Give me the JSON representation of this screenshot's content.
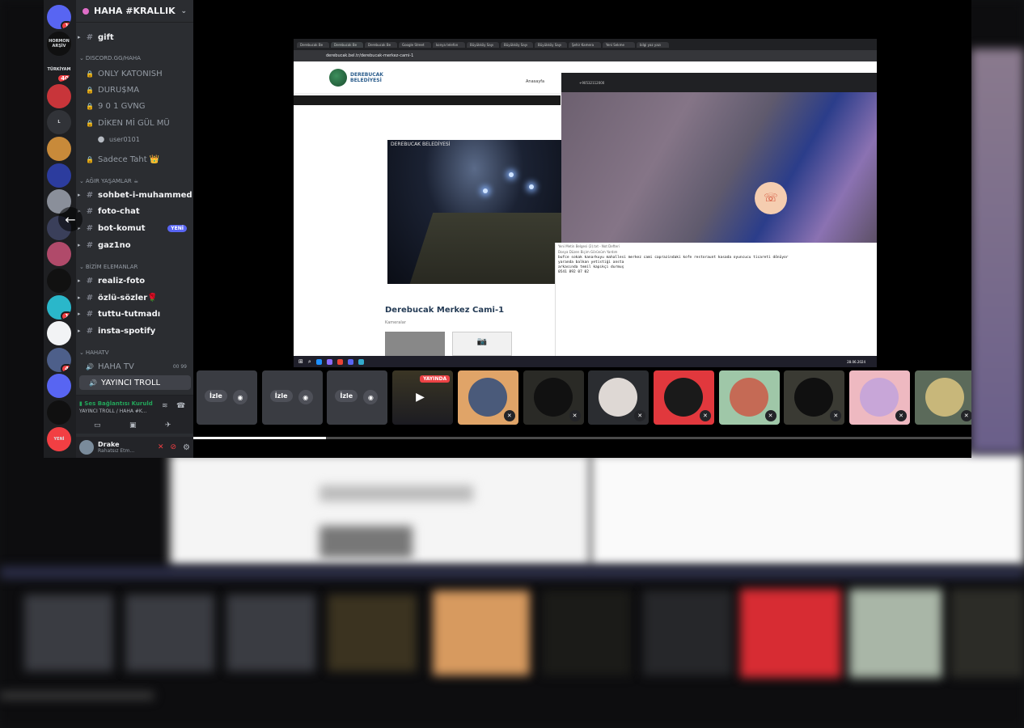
{
  "server": {
    "name": "HAHA #KRALLIK",
    "icons": [
      {
        "label": "",
        "badge": "1",
        "color": "#5865f2"
      },
      {
        "label": "HORMON ARŞİV",
        "badge": "",
        "color": "#101010"
      },
      {
        "label": "TÜRKİYAM",
        "badge": "40",
        "color": "#1e1f22"
      },
      {
        "label": "",
        "badge": "",
        "color": "#c8353a"
      },
      {
        "label": "L",
        "badge": "",
        "color": "#313338"
      },
      {
        "label": "",
        "badge": "",
        "color": "#c88a3a"
      },
      {
        "label": "",
        "badge": "",
        "color": "#2c3c9e"
      },
      {
        "label": "",
        "badge": "",
        "color": "#8a8f9a"
      },
      {
        "label": "",
        "badge": "",
        "color": "#3a3f5a"
      },
      {
        "label": "",
        "badge": "",
        "color": "#b04a6a"
      },
      {
        "label": "",
        "badge": "",
        "color": "#111"
      },
      {
        "label": "",
        "badge": "1",
        "color": "#2ab7ca"
      },
      {
        "label": "",
        "badge": "",
        "color": "#f2f3f5"
      },
      {
        "label": "",
        "badge": "4",
        "color": "#4d5f8a"
      },
      {
        "label": "",
        "badge": "",
        "color": "#5865f2"
      },
      {
        "label": "",
        "badge": "",
        "color": "#101010"
      },
      {
        "label": "YENİ",
        "badge": "",
        "color": "#f23f43"
      }
    ]
  },
  "channels": [
    {
      "type": "text",
      "label": "gift",
      "style": "bright"
    },
    {
      "type": "category",
      "label": "DISCORD.GG/HAHA"
    },
    {
      "type": "locked",
      "label": "ONLY KATONISH"
    },
    {
      "type": "locked",
      "label": "DURU$MA"
    },
    {
      "type": "locked",
      "label": "9 0 1 GVNG"
    },
    {
      "type": "locked",
      "label": "DİKEN Mİ GÜL MÜ"
    },
    {
      "type": "user",
      "label": "user0101"
    },
    {
      "type": "locked",
      "label": "Sadece Taht 👑"
    },
    {
      "type": "category",
      "label": "AĞIR YAŞAMLAR ☕"
    },
    {
      "type": "text",
      "label": "sohbet-i-muhammed",
      "style": "bright"
    },
    {
      "type": "text",
      "label": "foto-chat",
      "style": "bright"
    },
    {
      "type": "text",
      "label": "bot-komut",
      "style": "bright",
      "badge": "YENİ"
    },
    {
      "type": "text",
      "label": "gaz1no",
      "style": "bright"
    },
    {
      "type": "category",
      "label": "BİZİM ELEMANLAR"
    },
    {
      "type": "text",
      "label": "realiz-foto",
      "style": "bright"
    },
    {
      "type": "text",
      "label": "özlü-sözler🌹",
      "style": "bright"
    },
    {
      "type": "text",
      "label": "tuttu-tutmadı",
      "style": "bright"
    },
    {
      "type": "text",
      "label": "insta-spotify",
      "style": "bright"
    },
    {
      "type": "category",
      "label": "HAHATV"
    },
    {
      "type": "voice",
      "label": "HAHA TV",
      "extra": "00 99"
    },
    {
      "type": "voice",
      "label": "YAYINCI TROLL",
      "style": "sel"
    }
  ],
  "voice": {
    "status": "Ses Bağlantısı Kuruld",
    "location": "YAYINCI TROLL / HAHA #K..."
  },
  "user": {
    "name": "Drake",
    "status": "Rahatsız Etm..."
  },
  "browser": {
    "url": "derebucak.bel.tr/derebucak-merkez-cami-1",
    "tabs": [
      "Derebucak Be",
      "Derebucak Be",
      "Derebucak Be",
      "Google Street",
      "konya telefon",
      "Büyükköy Sayı",
      "Büyükköy Sayı",
      "Büyükköy Sayı",
      "Şehir Kamera",
      "Yeni Sekme",
      "bilgi yaz yazı"
    ],
    "logo_line1": "DEREBUCAK",
    "logo_line2": "BELEDİYESİ",
    "nav": "Anasayfa",
    "cam_label": "DEREBUCAK BELEDİYESİ",
    "page_title": "Derebucak Merkez Cami-1",
    "page_sub": "Kameralar",
    "call_number": "+90532112000",
    "notepad_title": "Yeni Metin Belgesi (2).txt - Not Defteri",
    "notepad_menu": "Dosya  Düzen  Biçim  Görünüm  Yardım",
    "notepad_lines": [
      "bufce sokak kanarkuyu mahallesi merkez cami caprazindaki kofe restoraunt kasada oyuncucu ticareti dönüyor",
      "yaranda balkan yetistiği ansta",
      "arkasında temil kapıkçi durmuş",
      "0541 892 07 02"
    ],
    "clock": "28.06.2024"
  },
  "participants": [
    {
      "kind": "watch",
      "label": "İzle"
    },
    {
      "kind": "watch",
      "label": "İzle"
    },
    {
      "kind": "watch",
      "label": "İzle"
    },
    {
      "kind": "live",
      "label": "YAYINDA"
    },
    {
      "kind": "avatar",
      "bg": "#e0a468",
      "fg": "#4a5a7a"
    },
    {
      "kind": "avatar",
      "bg": "#2a2a26",
      "fg": "#111"
    },
    {
      "kind": "avatar",
      "bg": "#2b2d31",
      "fg": "#ded8d4"
    },
    {
      "kind": "avatar",
      "bg": "#e1383d",
      "fg": "#1a1a1a"
    },
    {
      "kind": "avatar",
      "bg": "#9fc7a8",
      "fg": "#c56a55"
    },
    {
      "kind": "avatar",
      "bg": "#3a3a33",
      "fg": "#101010"
    },
    {
      "kind": "avatar",
      "bg": "#eeb9c1",
      "fg": "#c8a6d8"
    },
    {
      "kind": "avatar",
      "bg": "#5b6a5a",
      "fg": "#c8b77a"
    }
  ],
  "progress": 0.17
}
